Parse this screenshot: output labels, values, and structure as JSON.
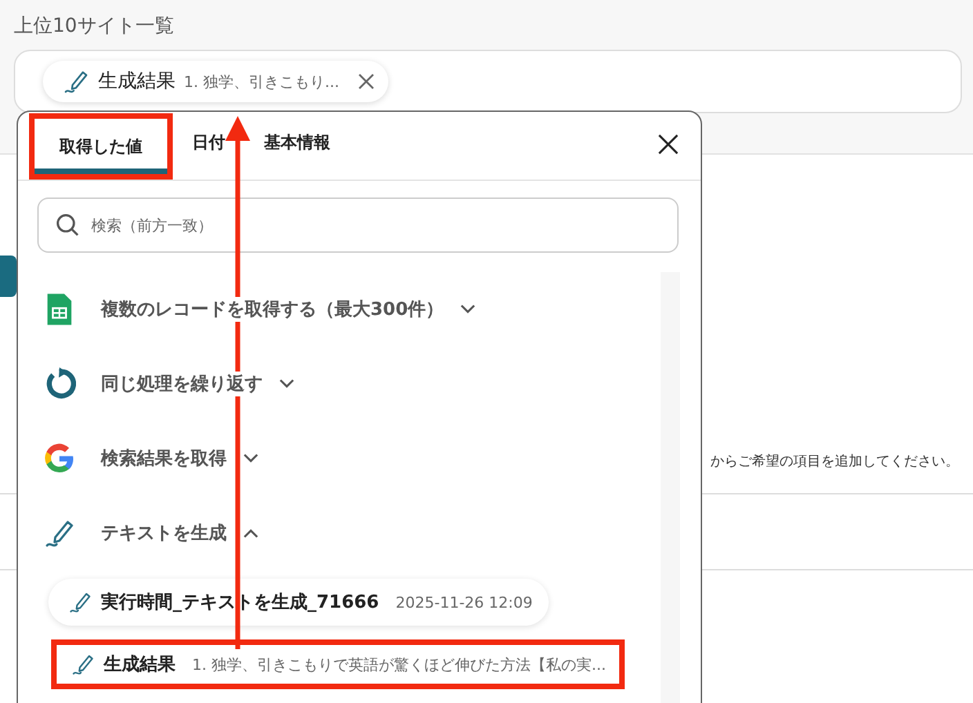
{
  "field": {
    "label": "上位10サイト一覧",
    "chip": {
      "name": "生成結果",
      "value": "1. 独学、引きこもり..."
    }
  },
  "background": {
    "hint": "からご希望の項目を追加してください。"
  },
  "popup": {
    "tabs": [
      {
        "label": "取得した値",
        "selected": true,
        "highlighted": true
      },
      {
        "label": "日付",
        "selected": false,
        "highlighted": false
      },
      {
        "label": "基本情報",
        "selected": false,
        "highlighted": false
      }
    ],
    "search": {
      "placeholder": "検索（前方一致）"
    },
    "groups": [
      {
        "kind": "sheets",
        "label": "複数のレコードを取得する（最大300件）",
        "expanded": false
      },
      {
        "kind": "loop",
        "label": "同じ処理を繰り返す",
        "expanded": false
      },
      {
        "kind": "google",
        "label": "検索結果を取得",
        "expanded": false
      },
      {
        "kind": "ai",
        "label": "テキストを生成",
        "expanded": true
      }
    ],
    "outputs": [
      {
        "name": "実行時間_テキストを生成_71666",
        "value": "2025-11-26 12:09",
        "highlighted": false
      },
      {
        "name": "生成結果",
        "value": "1. 独学、引きこもりで英語が驚くほど伸びた方法【私の実...",
        "highlighted": true
      }
    ]
  }
}
